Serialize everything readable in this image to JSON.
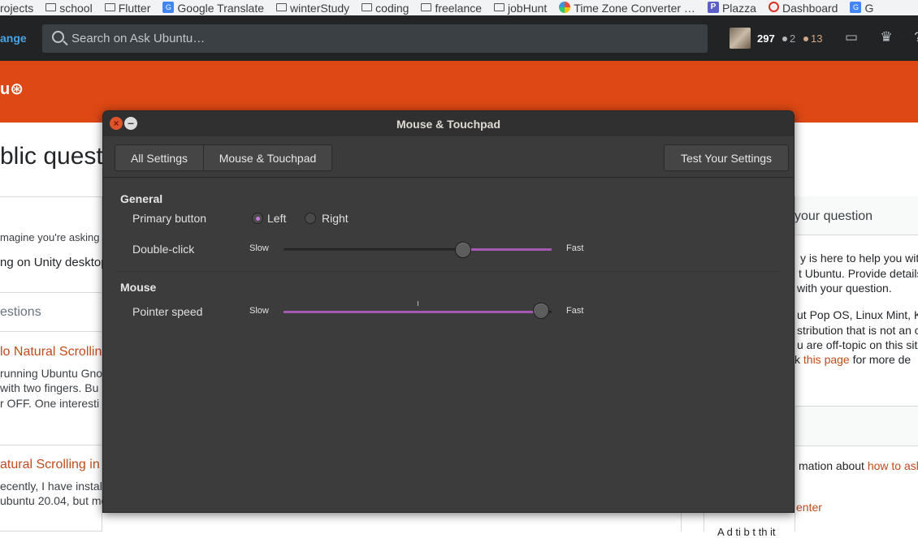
{
  "bookmarks": [
    {
      "label": "rojects",
      "icon": "folder-icon"
    },
    {
      "label": "school",
      "icon": "folder-icon"
    },
    {
      "label": "Flutter",
      "icon": "folder-icon"
    },
    {
      "label": "Google Translate",
      "icon": "google-translate-icon"
    },
    {
      "label": "winterStudy",
      "icon": "folder-icon"
    },
    {
      "label": "coding",
      "icon": "folder-icon"
    },
    {
      "label": "freelance",
      "icon": "folder-icon"
    },
    {
      "label": "jobHunt",
      "icon": "folder-icon"
    },
    {
      "label": "Time Zone Converter …",
      "icon": "time-zone-icon"
    },
    {
      "label": "Plazza",
      "icon": "plazza-icon"
    },
    {
      "label": "Dashboard",
      "icon": "dashboard-icon"
    },
    {
      "label": "G",
      "icon": "google-icon"
    }
  ],
  "topbar": {
    "site_fragment": "ange",
    "search_placeholder": "Search on Ask Ubuntu…",
    "reputation": "297",
    "silver": "2",
    "bronze": "13"
  },
  "header": {
    "logo_fragment": "u"
  },
  "background": {
    "title": "blic questi",
    "imagine": "magine you're asking",
    "input_value": "ng on Unity desktop",
    "similar": "estions",
    "q1_title": "lo Natural Scrollin",
    "q1_line1": "running Ubuntu Gno",
    "q1_line2": " with two fingers. Bu",
    "q1_line3": "r OFF. One interesti",
    "q2_title": "atural Scrolling in",
    "q2_line1": "ecently, I have instal",
    "q2_line2": "ubuntu 20.04, but me",
    "right_heading": "your question",
    "right_l1": "y is here to help you with",
    "right_l2": "t Ubuntu. Provide details",
    "right_l3": "with your question.",
    "right_l4": "ut Pop OS, Linux Mint, K",
    "right_l5": "stribution that is not an of",
    "right_l6": "u are off-topic on this site",
    "right_l7a": "k ",
    "right_l7b": "this page",
    "right_l7c": " for more de",
    "right_l8a": "mation about ",
    "right_l8b": "how to ask",
    "right_l9": "enter",
    "right_l10": "A d   ti     b  t th   it"
  },
  "dialog": {
    "title": "Mouse & Touchpad",
    "breadcrumb_all": "All Settings",
    "breadcrumb_current": "Mouse & Touchpad",
    "test_button": "Test Your Settings",
    "general_heading": "General",
    "primary_button_label": "Primary button",
    "left_label": "Left",
    "right_label": "Right",
    "primary_selected": "Left",
    "double_click_label": "Double-click",
    "slow": "Slow",
    "fast": "Fast",
    "double_click_value": 0.67,
    "mouse_heading": "Mouse",
    "pointer_speed_label": "Pointer speed",
    "pointer_speed_value": 0.96
  },
  "colors": {
    "accent": "#a35ab0",
    "orange": "#dd4814",
    "dialog_bg": "#3c3c3c"
  }
}
